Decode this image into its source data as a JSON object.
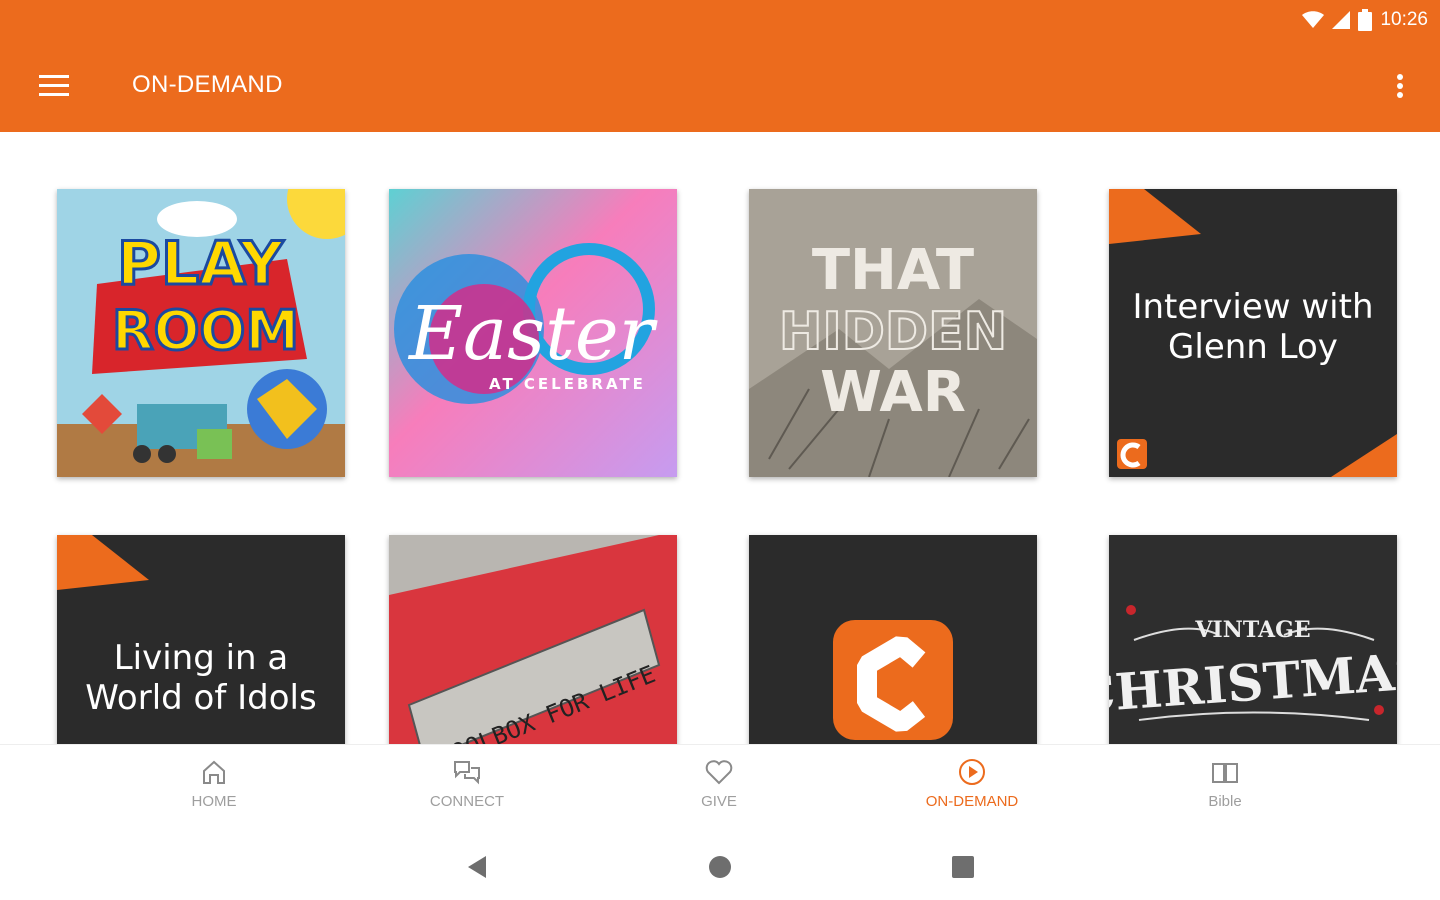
{
  "status": {
    "time": "10:26"
  },
  "appbar": {
    "title": "ON-DEMAND"
  },
  "tiles": {
    "interview": {
      "title_line1": "Interview with",
      "title_line2": "Glenn Loy"
    },
    "idols": {
      "title_line1": "Living in a",
      "title_line2": "World of Idols"
    },
    "playroom": {
      "line1": "PLAY",
      "line2": "ROOM"
    },
    "easter": {
      "script": "Easter",
      "sub": "AT CELEBRATE"
    },
    "hidden": {
      "line1": "THAT",
      "line2": "HIDDEN",
      "line3": "WAR"
    },
    "toolbox": {
      "text": "TOOLBOX FOR LIFE"
    },
    "christmas": {
      "line1": "VINTAGE",
      "line2": "CHRISTMAS"
    }
  },
  "nav": {
    "home": "HOME",
    "connect": "CONNECT",
    "give": "GIVE",
    "ondemand": "ON-DEMAND",
    "bible": "Bible"
  },
  "colors": {
    "accent": "#ec6b1d",
    "tile_dark": "#2b2b2b",
    "inactive": "#9e9e9e"
  }
}
